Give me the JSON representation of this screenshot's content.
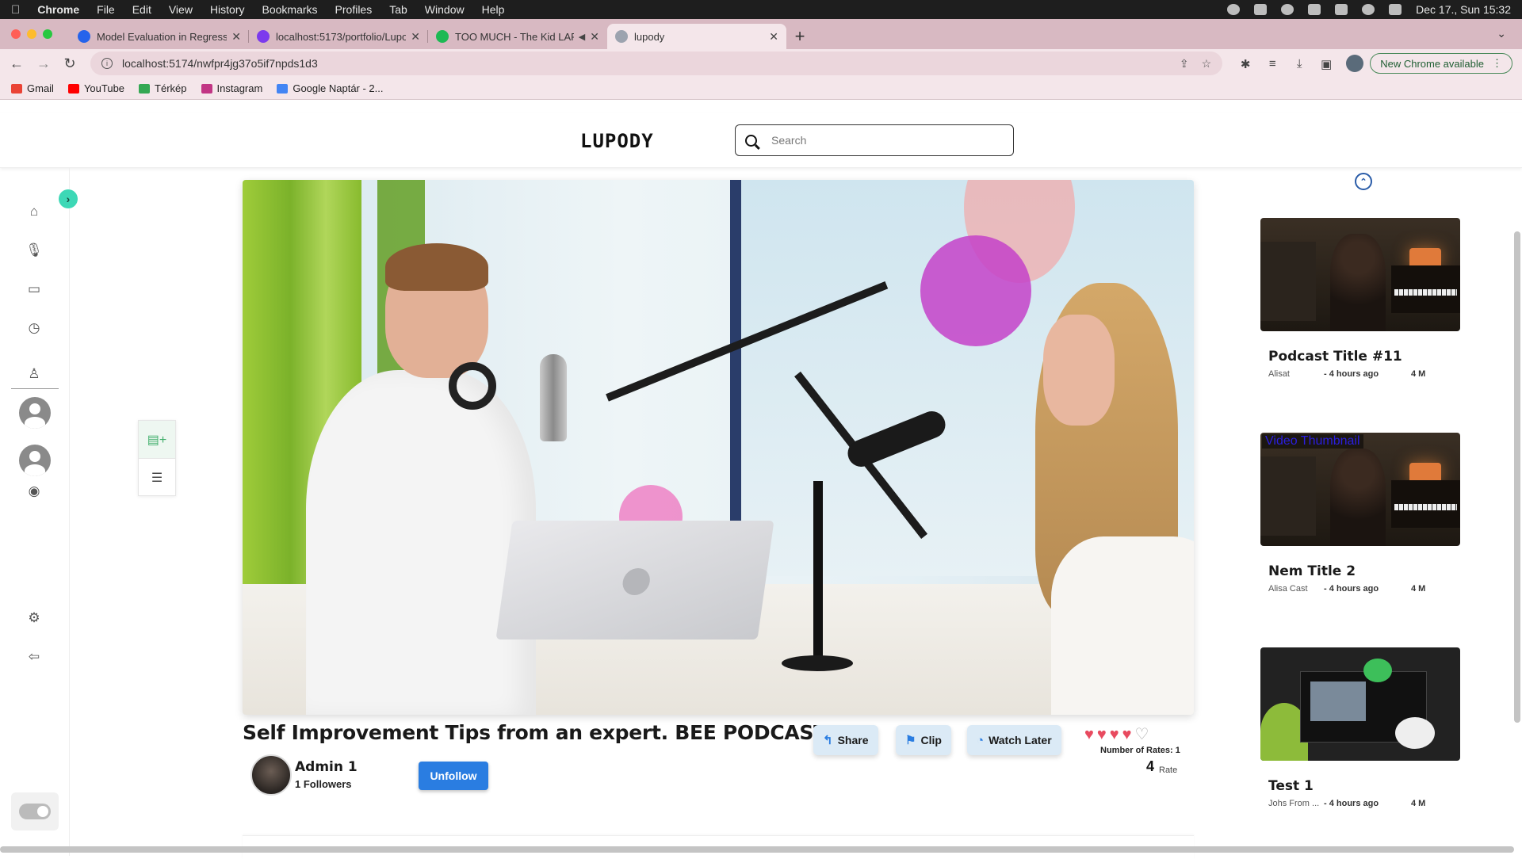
{
  "menubar": {
    "app": "Chrome",
    "items": [
      "File",
      "Edit",
      "View",
      "History",
      "Bookmarks",
      "Profiles",
      "Tab",
      "Window",
      "Help"
    ],
    "datetime": "Dec 17., Sun  15:32"
  },
  "tabs": [
    {
      "title": "Model Evaluation in Regressio",
      "favicon_color": "#2563eb"
    },
    {
      "title": "localhost:5173/portfolio/Lupo",
      "favicon_color": "#7c3aed"
    },
    {
      "title": "TOO MUCH - The Kid LAR",
      "favicon_color": "#1db954"
    },
    {
      "title": "lupody",
      "favicon_color": "#9ca3af"
    }
  ],
  "toolbar": {
    "url": "localhost:5174/nwfpr4jg37o5if7npds1d3",
    "update_label": "New Chrome available"
  },
  "bookmarks": [
    {
      "label": "Gmail",
      "color": "#ea4335"
    },
    {
      "label": "YouTube",
      "color": "#ff0000"
    },
    {
      "label": "Térkép",
      "color": "#34a853"
    },
    {
      "label": "Instagram",
      "color": "#c13584"
    },
    {
      "label": "Google Naptár - 2...",
      "color": "#4285f4"
    }
  ],
  "header": {
    "logo": "LUPODY",
    "search_placeholder": "Search"
  },
  "sidebar": {
    "icons": [
      "home-icon",
      "microphone-icon",
      "tv-icon",
      "clock-icon",
      "user-icon",
      "avatar",
      "avatar",
      "eye-icon",
      "gear-icon",
      "logout-icon"
    ]
  },
  "player": {
    "title": "Self Improvement Tips from an expert. BEE PODCAST...",
    "author": "Admin 1",
    "followers": "1 Followers",
    "unfollow_label": "Unfollow",
    "actions": {
      "share": "Share",
      "clip": "Clip",
      "watch_later": "Watch Later"
    },
    "rating": {
      "value": 4,
      "max": 5,
      "count_label": "Number of Rates: 1",
      "rate_value": "4",
      "rate_label": "Rate"
    }
  },
  "recommendations": [
    {
      "title": "Podcast Title #11",
      "channel": "Alisat",
      "time": "- 4 hours ago",
      "views": "4 M",
      "thumb": "studio"
    },
    {
      "title": "Nem Title 2",
      "channel": "Alisa Cast",
      "time": "- 4 hours ago",
      "views": "4 M",
      "thumb": "studio-broken",
      "alt": "Video Thumbnail"
    },
    {
      "title": "Test 1",
      "channel": "Johs From ...",
      "time": "- 4 hours ago",
      "views": "4 M",
      "thumb": "dark"
    }
  ],
  "colors": {
    "accent": "#2a7de1",
    "heart": "#e84a5f",
    "expand": "#3dd8b6"
  }
}
